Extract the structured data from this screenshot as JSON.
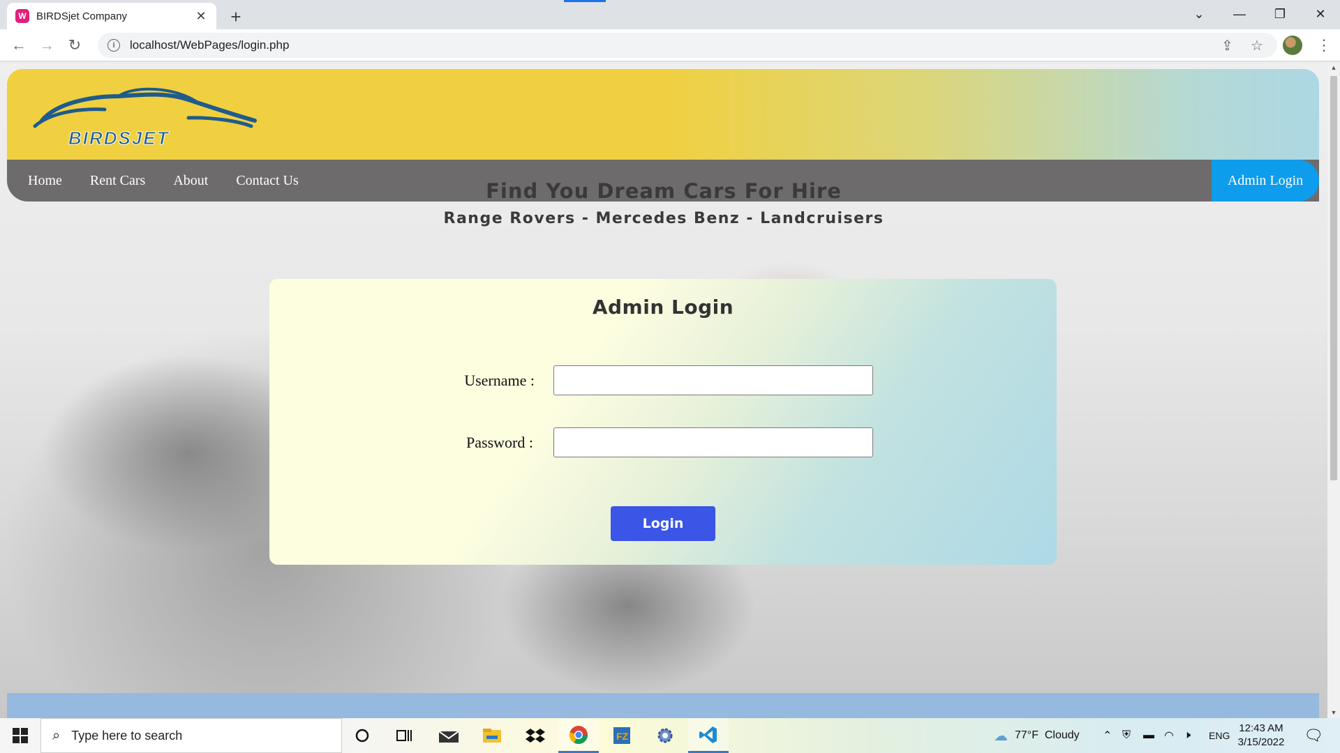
{
  "browser": {
    "tab_title": "BIRDSjet Company",
    "tab_favicon_text": "W",
    "tab_close": "✕",
    "new_tab": "+",
    "url": "localhost/WebPages/login.php",
    "window_controls": {
      "dropdown": "⌄",
      "minimize": "—",
      "restore": "❐",
      "close": "✕"
    },
    "toolbar": {
      "back": "←",
      "forward": "→",
      "reload": "↻",
      "share": "⇪",
      "bookmark": "☆",
      "menu": "⋮"
    }
  },
  "site": {
    "logo_text": "BIRDSJET",
    "nav": {
      "home": "Home",
      "rent_cars": "Rent Cars",
      "about": "About",
      "contact_us": "Contact Us"
    },
    "admin_login_button": "Admin Login",
    "hero_title": "Find You Dream Cars For Hire",
    "hero_subtitle": "Range Rovers - Mercedes Benz - Landcruisers",
    "login_form": {
      "title": "Admin Login",
      "username_label": "Username :",
      "username_value": "",
      "password_label": "Password :",
      "password_value": "",
      "submit_label": "Login"
    },
    "colors": {
      "header_yellow": "#f0d040",
      "nav_gray": "#6d6b6b",
      "admin_blue": "#0e9cec",
      "login_button": "#3b55e6",
      "footer_blue": "#95b9df"
    }
  },
  "taskbar": {
    "search_placeholder": "Type here to search",
    "apps": [
      "cortana-icon",
      "task-view-icon",
      "mail-icon",
      "file-explorer-icon",
      "dropbox-icon",
      "chrome-icon",
      "filezilla-icon",
      "settings-gear-icon",
      "vscode-icon"
    ],
    "weather": "77°F  Cloudy",
    "language": "ENG",
    "time": "12:43 AM",
    "date": "3/15/2022"
  }
}
